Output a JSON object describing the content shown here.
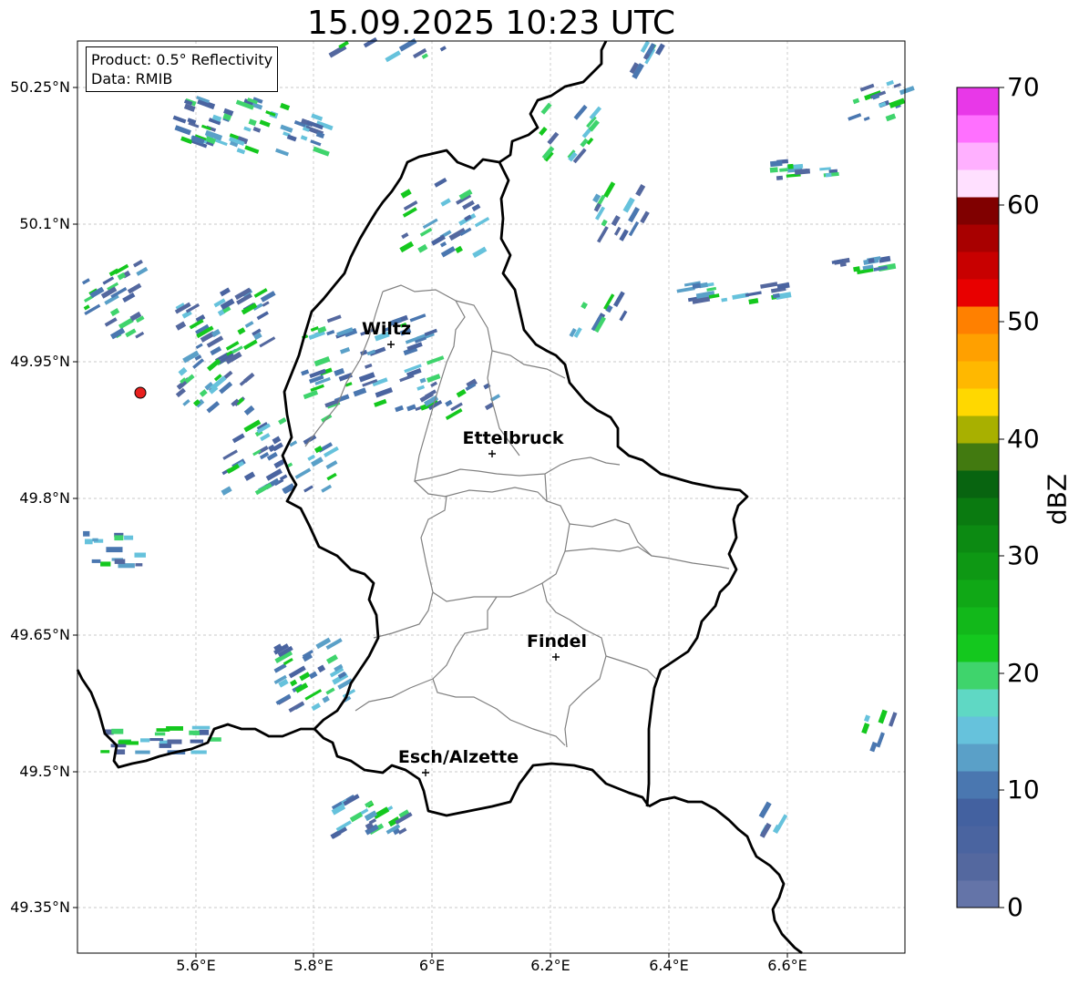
{
  "title": "15.09.2025 10:23 UTC",
  "info": {
    "product": "Product: 0.5° Reflectivity",
    "data": "Data: RMIB"
  },
  "lat_labels": [
    "50.25°N",
    "50.1°N",
    "49.95°N",
    "49.8°N",
    "49.65°N",
    "49.5°N",
    "49.35°N"
  ],
  "lon_labels": [
    "5.6°E",
    "5.8°E",
    "6°E",
    "6.2°E",
    "6.4°E",
    "6.6°E"
  ],
  "cities": [
    {
      "name": "Wiltz"
    },
    {
      "name": "Ettelbruck"
    },
    {
      "name": "Findel"
    },
    {
      "name": "Esch/Alzette"
    }
  ],
  "colorbar": {
    "label": "dBZ",
    "ticks": [
      "0",
      "10",
      "20",
      "30",
      "40",
      "50",
      "60",
      "70"
    ],
    "colors": [
      "#6474a8",
      "#54689f",
      "#4a64a0",
      "#4361a0",
      "#4a77b0",
      "#5aa0c8",
      "#66c2dc",
      "#5fd8c4",
      "#3fd46c",
      "#14c81e",
      "#12b81a",
      "#10a816",
      "#0e9814",
      "#0c8a12",
      "#0a7a10",
      "#086410",
      "#427a10",
      "#a8b000",
      "#ffd800",
      "#ffb800",
      "#ffa000",
      "#ff8000",
      "#e80000",
      "#c80000",
      "#a80000",
      "#800000",
      "#ffe0ff",
      "#ffb0ff",
      "#ff70ff",
      "#e838e8"
    ]
  },
  "radar": {
    "name": "radar-site",
    "color": "#e8201e"
  }
}
